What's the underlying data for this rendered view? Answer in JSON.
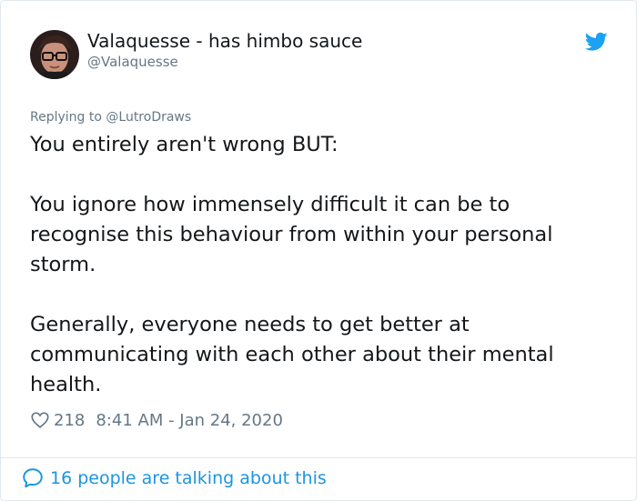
{
  "tweet": {
    "author_name": "Valaquesse - has himbo sauce",
    "author_handle": "@Valaquesse",
    "replying_prefix": "Replying to",
    "replying_to": "@LutroDraws",
    "paragraphs": [
      "You entirely aren't wrong BUT:",
      "You ignore how immensely difficult it can be to recognise this behaviour from within your personal storm.",
      "Generally, everyone needs to get better at communicating with each other about their mental health."
    ],
    "like_count": "218",
    "timestamp": "8:41 AM - Jan 24, 2020",
    "talking_text": "16 people are talking about this"
  },
  "icons": {
    "brand": "twitter-bird-icon",
    "like": "heart-icon",
    "reply": "speech-bubble-icon"
  },
  "colors": {
    "brand_blue": "#1da1f2",
    "link_blue": "#1b95e0",
    "muted": "#657786",
    "text": "#14171a"
  }
}
